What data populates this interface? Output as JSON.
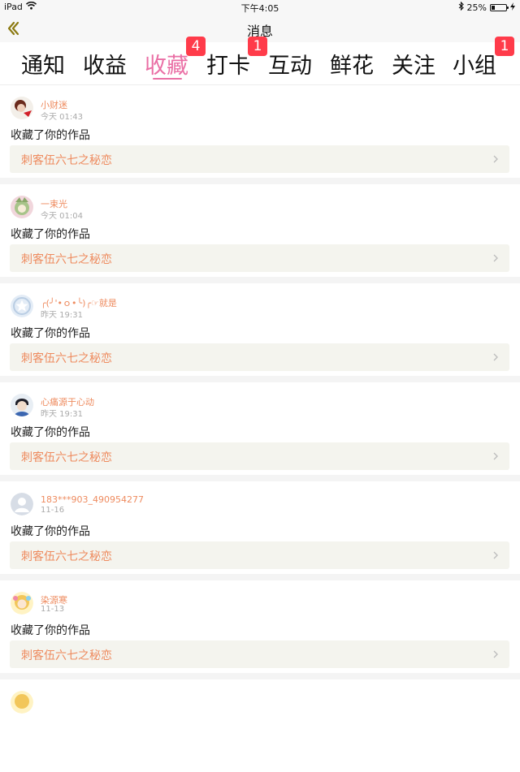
{
  "status": {
    "device": "iPad",
    "time": "下午4:05",
    "battery": "25%",
    "battery_fraction": 0.25
  },
  "nav": {
    "title": "消息",
    "back_icon": "chevron-left-icon"
  },
  "tabs": [
    {
      "label": "通知"
    },
    {
      "label": "收益"
    },
    {
      "label": "收藏",
      "badge": "4",
      "active": true
    },
    {
      "label": "打卡",
      "badge": "1"
    },
    {
      "label": "互动"
    },
    {
      "label": "鲜花"
    },
    {
      "label": "关注"
    },
    {
      "label": "小组",
      "badge": "1"
    }
  ],
  "colors": {
    "accent": "#ea6fa5",
    "badge": "#ff3b4a",
    "name": "#ee8b5f"
  },
  "items": [
    {
      "username": "小财迷",
      "time": "今天 01:43",
      "action": "收藏了你的作品",
      "work": "刺客伍六七之秘恋"
    },
    {
      "username": "一束光",
      "time": "今天 01:04",
      "action": "收藏了你的作品",
      "work": "刺客伍六七之秘恋"
    },
    {
      "username": "╭(╯'•ｏ•╰)╭☞就是",
      "time": "昨天 19:31",
      "action": "收藏了你的作品",
      "work": "刺客伍六七之秘恋"
    },
    {
      "username": "心痛源于心动",
      "time": "昨天 19:31",
      "action": "收藏了你的作品",
      "work": "刺客伍六七之秘恋"
    },
    {
      "username": "183***903_490954277",
      "time": "11-16",
      "action": "收藏了你的作品",
      "work": "刺客伍六七之秘恋"
    },
    {
      "username": "染源寒",
      "time": "11-13",
      "action": "收藏了你的作品",
      "work": "刺客伍六七之秘恋"
    }
  ]
}
